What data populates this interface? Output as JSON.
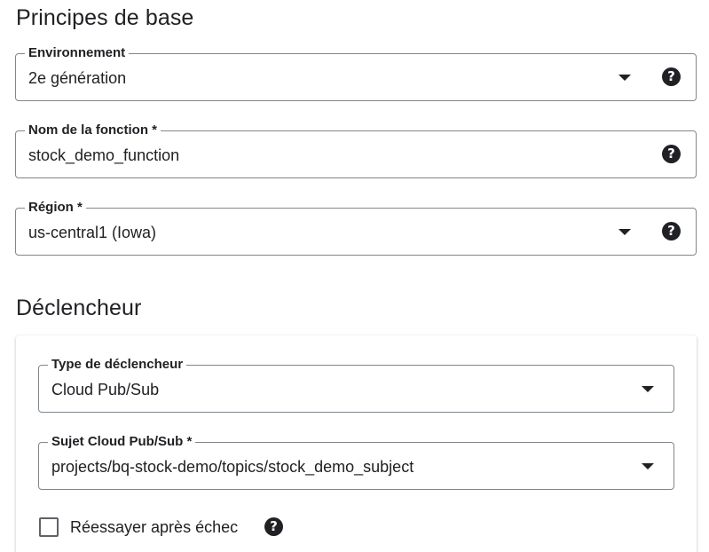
{
  "basics": {
    "title": "Principes de base",
    "environment": {
      "label": "Environnement",
      "value": "2e génération"
    },
    "function_name": {
      "label": "Nom de la fonction *",
      "value": "stock_demo_function"
    },
    "region": {
      "label": "Région *",
      "value": "us-central1 (Iowa)"
    }
  },
  "trigger": {
    "title": "Déclencheur",
    "trigger_type": {
      "label": "Type de déclencheur",
      "value": "Cloud Pub/Sub"
    },
    "pubsub_topic": {
      "label": "Sujet Cloud Pub/Sub *",
      "value": "projects/bq-stock-demo/topics/stock_demo_subject"
    },
    "retry": {
      "label": "Réessayer après échec",
      "checked": false
    }
  },
  "icons": {
    "help": "help-circle-icon",
    "dropdown": "arrow-drop-down-icon",
    "help_glyph": "?"
  },
  "colors": {
    "text": "#202124",
    "border": "#80868b",
    "checkbox_border": "#5f6368"
  }
}
